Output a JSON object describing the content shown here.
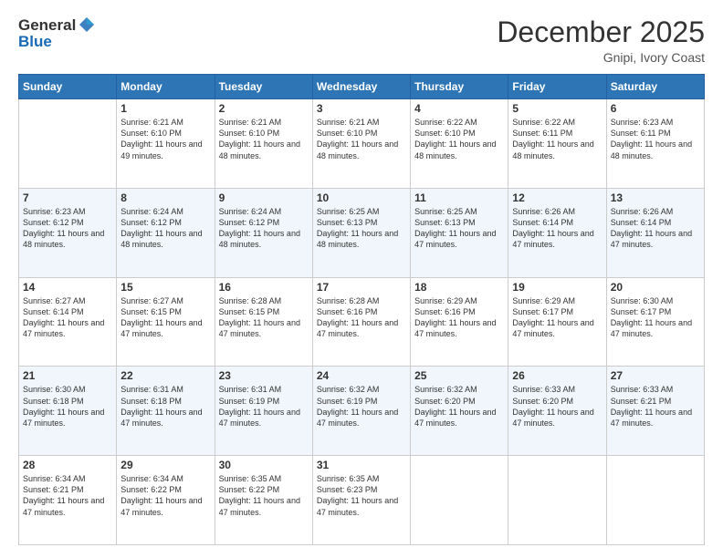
{
  "header": {
    "logo_general": "General",
    "logo_blue": "Blue",
    "month_title": "December 2025",
    "location": "Gnipi, Ivory Coast"
  },
  "days_of_week": [
    "Sunday",
    "Monday",
    "Tuesday",
    "Wednesday",
    "Thursday",
    "Friday",
    "Saturday"
  ],
  "weeks": [
    [
      {
        "day": "",
        "sunrise": "",
        "sunset": "",
        "daylight": ""
      },
      {
        "day": "1",
        "sunrise": "Sunrise: 6:21 AM",
        "sunset": "Sunset: 6:10 PM",
        "daylight": "Daylight: 11 hours and 49 minutes."
      },
      {
        "day": "2",
        "sunrise": "Sunrise: 6:21 AM",
        "sunset": "Sunset: 6:10 PM",
        "daylight": "Daylight: 11 hours and 48 minutes."
      },
      {
        "day": "3",
        "sunrise": "Sunrise: 6:21 AM",
        "sunset": "Sunset: 6:10 PM",
        "daylight": "Daylight: 11 hours and 48 minutes."
      },
      {
        "day": "4",
        "sunrise": "Sunrise: 6:22 AM",
        "sunset": "Sunset: 6:10 PM",
        "daylight": "Daylight: 11 hours and 48 minutes."
      },
      {
        "day": "5",
        "sunrise": "Sunrise: 6:22 AM",
        "sunset": "Sunset: 6:11 PM",
        "daylight": "Daylight: 11 hours and 48 minutes."
      },
      {
        "day": "6",
        "sunrise": "Sunrise: 6:23 AM",
        "sunset": "Sunset: 6:11 PM",
        "daylight": "Daylight: 11 hours and 48 minutes."
      }
    ],
    [
      {
        "day": "7",
        "sunrise": "Sunrise: 6:23 AM",
        "sunset": "Sunset: 6:12 PM",
        "daylight": "Daylight: 11 hours and 48 minutes."
      },
      {
        "day": "8",
        "sunrise": "Sunrise: 6:24 AM",
        "sunset": "Sunset: 6:12 PM",
        "daylight": "Daylight: 11 hours and 48 minutes."
      },
      {
        "day": "9",
        "sunrise": "Sunrise: 6:24 AM",
        "sunset": "Sunset: 6:12 PM",
        "daylight": "Daylight: 11 hours and 48 minutes."
      },
      {
        "day": "10",
        "sunrise": "Sunrise: 6:25 AM",
        "sunset": "Sunset: 6:13 PM",
        "daylight": "Daylight: 11 hours and 48 minutes."
      },
      {
        "day": "11",
        "sunrise": "Sunrise: 6:25 AM",
        "sunset": "Sunset: 6:13 PM",
        "daylight": "Daylight: 11 hours and 47 minutes."
      },
      {
        "day": "12",
        "sunrise": "Sunrise: 6:26 AM",
        "sunset": "Sunset: 6:14 PM",
        "daylight": "Daylight: 11 hours and 47 minutes."
      },
      {
        "day": "13",
        "sunrise": "Sunrise: 6:26 AM",
        "sunset": "Sunset: 6:14 PM",
        "daylight": "Daylight: 11 hours and 47 minutes."
      }
    ],
    [
      {
        "day": "14",
        "sunrise": "Sunrise: 6:27 AM",
        "sunset": "Sunset: 6:14 PM",
        "daylight": "Daylight: 11 hours and 47 minutes."
      },
      {
        "day": "15",
        "sunrise": "Sunrise: 6:27 AM",
        "sunset": "Sunset: 6:15 PM",
        "daylight": "Daylight: 11 hours and 47 minutes."
      },
      {
        "day": "16",
        "sunrise": "Sunrise: 6:28 AM",
        "sunset": "Sunset: 6:15 PM",
        "daylight": "Daylight: 11 hours and 47 minutes."
      },
      {
        "day": "17",
        "sunrise": "Sunrise: 6:28 AM",
        "sunset": "Sunset: 6:16 PM",
        "daylight": "Daylight: 11 hours and 47 minutes."
      },
      {
        "day": "18",
        "sunrise": "Sunrise: 6:29 AM",
        "sunset": "Sunset: 6:16 PM",
        "daylight": "Daylight: 11 hours and 47 minutes."
      },
      {
        "day": "19",
        "sunrise": "Sunrise: 6:29 AM",
        "sunset": "Sunset: 6:17 PM",
        "daylight": "Daylight: 11 hours and 47 minutes."
      },
      {
        "day": "20",
        "sunrise": "Sunrise: 6:30 AM",
        "sunset": "Sunset: 6:17 PM",
        "daylight": "Daylight: 11 hours and 47 minutes."
      }
    ],
    [
      {
        "day": "21",
        "sunrise": "Sunrise: 6:30 AM",
        "sunset": "Sunset: 6:18 PM",
        "daylight": "Daylight: 11 hours and 47 minutes."
      },
      {
        "day": "22",
        "sunrise": "Sunrise: 6:31 AM",
        "sunset": "Sunset: 6:18 PM",
        "daylight": "Daylight: 11 hours and 47 minutes."
      },
      {
        "day": "23",
        "sunrise": "Sunrise: 6:31 AM",
        "sunset": "Sunset: 6:19 PM",
        "daylight": "Daylight: 11 hours and 47 minutes."
      },
      {
        "day": "24",
        "sunrise": "Sunrise: 6:32 AM",
        "sunset": "Sunset: 6:19 PM",
        "daylight": "Daylight: 11 hours and 47 minutes."
      },
      {
        "day": "25",
        "sunrise": "Sunrise: 6:32 AM",
        "sunset": "Sunset: 6:20 PM",
        "daylight": "Daylight: 11 hours and 47 minutes."
      },
      {
        "day": "26",
        "sunrise": "Sunrise: 6:33 AM",
        "sunset": "Sunset: 6:20 PM",
        "daylight": "Daylight: 11 hours and 47 minutes."
      },
      {
        "day": "27",
        "sunrise": "Sunrise: 6:33 AM",
        "sunset": "Sunset: 6:21 PM",
        "daylight": "Daylight: 11 hours and 47 minutes."
      }
    ],
    [
      {
        "day": "28",
        "sunrise": "Sunrise: 6:34 AM",
        "sunset": "Sunset: 6:21 PM",
        "daylight": "Daylight: 11 hours and 47 minutes."
      },
      {
        "day": "29",
        "sunrise": "Sunrise: 6:34 AM",
        "sunset": "Sunset: 6:22 PM",
        "daylight": "Daylight: 11 hours and 47 minutes."
      },
      {
        "day": "30",
        "sunrise": "Sunrise: 6:35 AM",
        "sunset": "Sunset: 6:22 PM",
        "daylight": "Daylight: 11 hours and 47 minutes."
      },
      {
        "day": "31",
        "sunrise": "Sunrise: 6:35 AM",
        "sunset": "Sunset: 6:23 PM",
        "daylight": "Daylight: 11 hours and 47 minutes."
      },
      {
        "day": "",
        "sunrise": "",
        "sunset": "",
        "daylight": ""
      },
      {
        "day": "",
        "sunrise": "",
        "sunset": "",
        "daylight": ""
      },
      {
        "day": "",
        "sunrise": "",
        "sunset": "",
        "daylight": ""
      }
    ]
  ]
}
